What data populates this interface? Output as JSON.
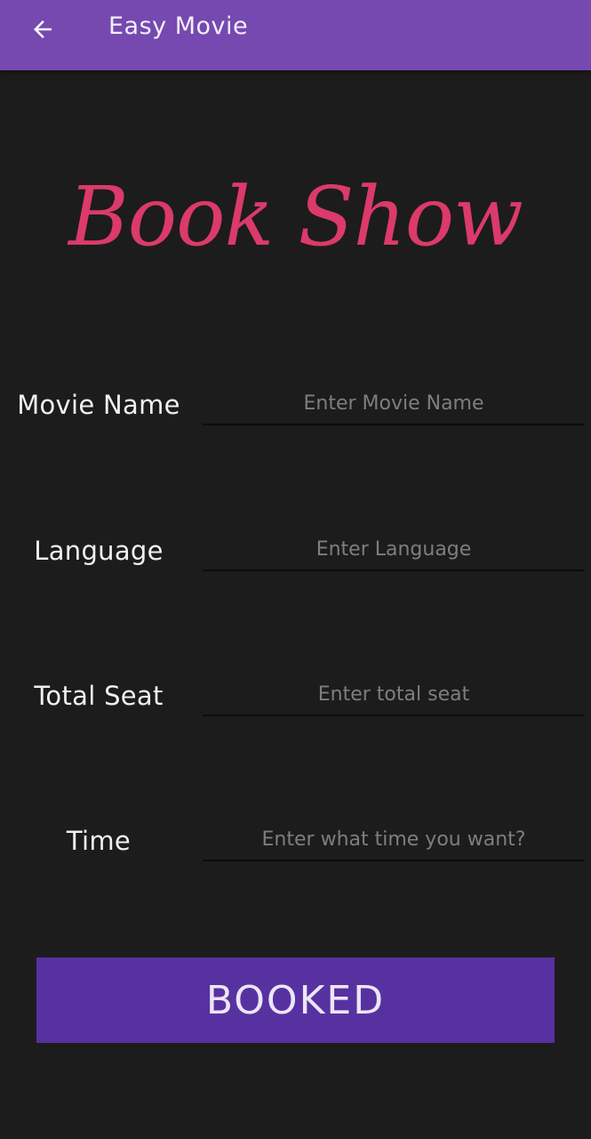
{
  "appbar": {
    "title": "Easy Movie",
    "back_icon": "arrow-left-icon",
    "background_color": "#7549b0"
  },
  "hero": {
    "title": "Book Show",
    "color": "#db3a6a"
  },
  "form": {
    "movie_name": {
      "label": "Movie Name",
      "placeholder": "Enter Movie Name",
      "value": ""
    },
    "language": {
      "label": "Language",
      "placeholder": "Enter Language",
      "value": ""
    },
    "total_seat": {
      "label": "Total Seat",
      "placeholder": "Enter total seat",
      "value": ""
    },
    "time": {
      "label": "Time",
      "placeholder": "Enter what time you want?",
      "value": ""
    }
  },
  "booked_button": {
    "label": "BOOKED",
    "color": "#5831a1"
  },
  "background_color": "#1c1c1c"
}
